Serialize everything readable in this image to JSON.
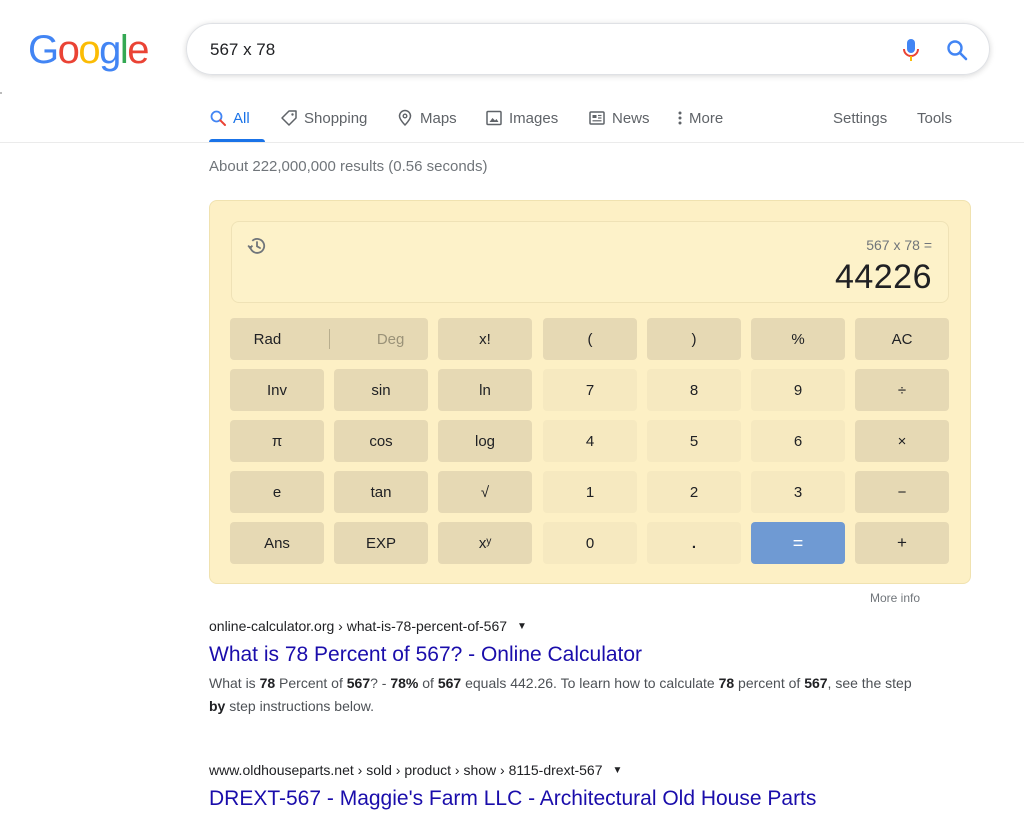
{
  "logo": {
    "letters": [
      "G",
      "o",
      "o",
      "g",
      "l",
      "e"
    ],
    "colors": [
      "#4285F4",
      "#EA4335",
      "#FBBC05",
      "#4285F4",
      "#34A853",
      "#EA4335"
    ]
  },
  "search": {
    "query": "567 x 78"
  },
  "tabs": [
    {
      "label": "All",
      "icon": "search-icon",
      "active": true
    },
    {
      "label": "Shopping",
      "icon": "tag-icon"
    },
    {
      "label": "Maps",
      "icon": "map-pin-icon"
    },
    {
      "label": "Images",
      "icon": "image-icon"
    },
    {
      "label": "News",
      "icon": "news-icon"
    },
    {
      "label": "More",
      "icon": "more-vertical-icon"
    }
  ],
  "tools": {
    "settings": "Settings",
    "tools": "Tools"
  },
  "stats": "About 222,000,000 results (0.56 seconds)",
  "calculator": {
    "expression": "567 x 78 =",
    "result": "44226",
    "keys": {
      "rad": "Rad",
      "deg": "Deg",
      "fact": "x!",
      "lparen": "(",
      "rparen": ")",
      "percent": "%",
      "ac": "AC",
      "inv": "Inv",
      "sin": "sin",
      "ln": "ln",
      "n7": "7",
      "n8": "8",
      "n9": "9",
      "divide": "÷",
      "pi": "π",
      "cos": "cos",
      "log": "log",
      "n4": "4",
      "n5": "5",
      "n6": "6",
      "multiply": "×",
      "e": "e",
      "tan": "tan",
      "sqrt": "√",
      "n1": "1",
      "n2": "2",
      "n3": "3",
      "minus": "−",
      "ans": "Ans",
      "exp": "EXP",
      "pow": "xʸ",
      "n0": "0",
      "dot": ".",
      "equals": "=",
      "plus": "+"
    },
    "more_info": "More info"
  },
  "results": [
    {
      "cite": "online-calculator.org › what-is-78-percent-of-567",
      "title": "What is 78 Percent of 567? - Online Calculator",
      "snippet_parts": [
        "What is ",
        "78",
        " Percent of ",
        "567",
        "? - ",
        "78%",
        " of ",
        "567",
        " equals 442.26. To learn how to calculate ",
        "78",
        " percent of ",
        "567",
        ", see the step ",
        "by",
        " step instructions below."
      ]
    },
    {
      "cite": "www.oldhouseparts.net › sold › product › show › 8115-drext-567",
      "title": "DREXT-567 - Maggie's Farm LLC - Architectural Old House Parts"
    }
  ]
}
